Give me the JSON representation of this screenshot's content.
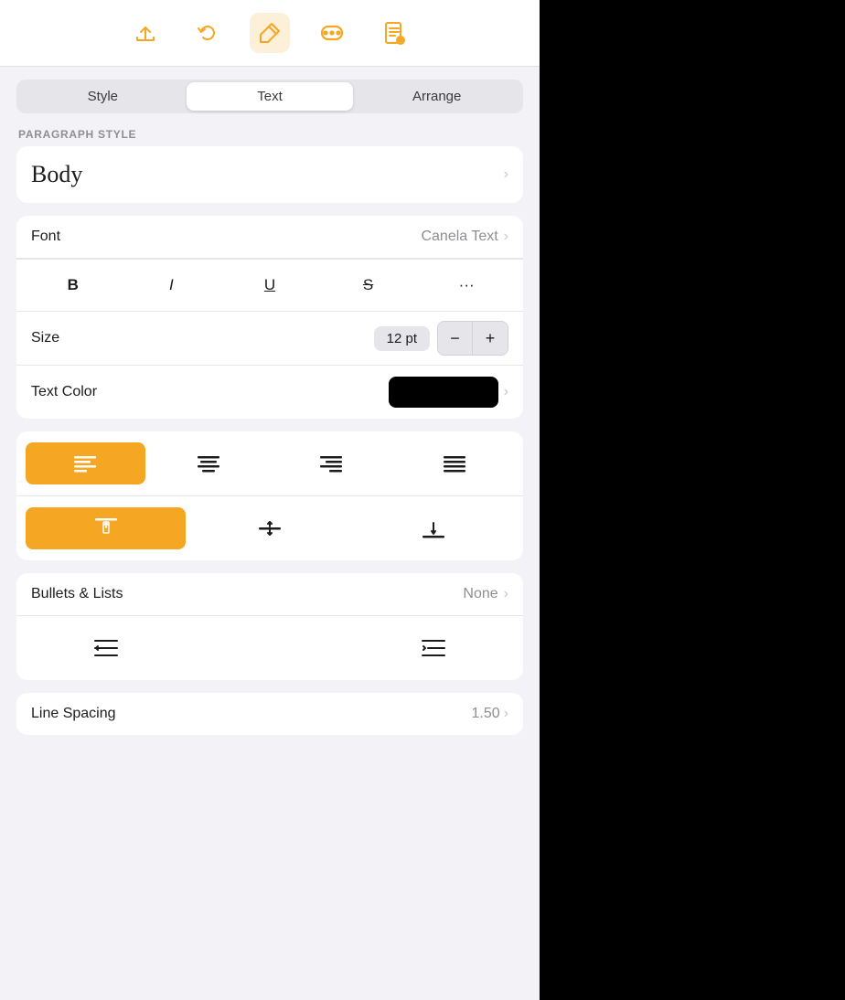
{
  "toolbar": {
    "icons": [
      {
        "name": "share-icon",
        "label": "Share"
      },
      {
        "name": "undo-icon",
        "label": "Undo"
      },
      {
        "name": "pen-icon",
        "label": "Format",
        "active": true
      },
      {
        "name": "more-icon",
        "label": "More"
      },
      {
        "name": "document-icon",
        "label": "Document"
      }
    ]
  },
  "tabs": [
    {
      "id": "style",
      "label": "Style"
    },
    {
      "id": "text",
      "label": "Text",
      "active": true
    },
    {
      "id": "arrange",
      "label": "Arrange"
    }
  ],
  "paragraph_style": {
    "section_label": "PARAGRAPH STYLE",
    "value": "Body"
  },
  "font": {
    "label": "Font",
    "value": "Canela Text"
  },
  "format_buttons": [
    {
      "id": "bold",
      "label": "B"
    },
    {
      "id": "italic",
      "label": "I"
    },
    {
      "id": "underline",
      "label": "U"
    },
    {
      "id": "strikethrough",
      "label": "S"
    },
    {
      "id": "more",
      "label": "···"
    }
  ],
  "size": {
    "label": "Size",
    "value": "12 pt",
    "decrement_label": "−",
    "increment_label": "+"
  },
  "text_color": {
    "label": "Text Color",
    "color": "#000000"
  },
  "alignment": {
    "buttons": [
      {
        "id": "align-left",
        "active": true
      },
      {
        "id": "align-center",
        "active": false
      },
      {
        "id": "align-right",
        "active": false
      },
      {
        "id": "align-justify",
        "active": false
      }
    ]
  },
  "vertical_alignment": {
    "buttons": [
      {
        "id": "valign-top",
        "active": true
      },
      {
        "id": "valign-middle",
        "active": false
      },
      {
        "id": "valign-bottom",
        "active": false
      }
    ]
  },
  "bullets_lists": {
    "label": "Bullets & Lists",
    "value": "None"
  },
  "indent": {
    "decrease_label": "≡←",
    "increase_label": "→≡"
  },
  "line_spacing": {
    "label": "Line Spacing",
    "value": "1.50"
  }
}
